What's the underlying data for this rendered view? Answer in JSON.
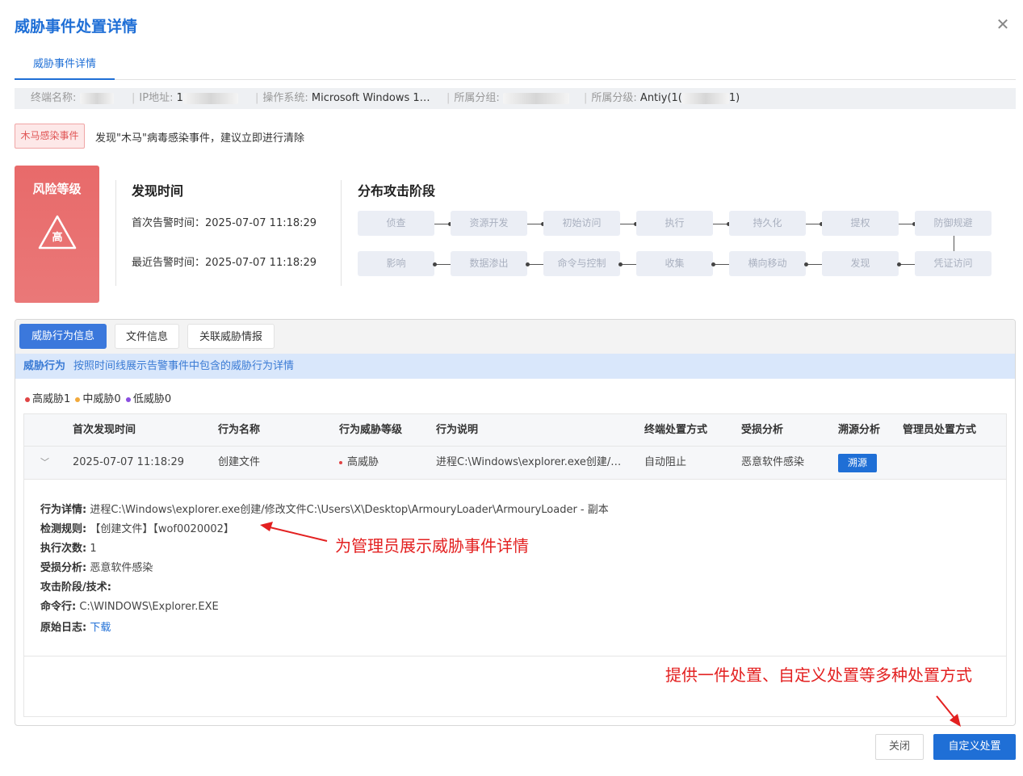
{
  "dialog": {
    "title": "威胁事件处置详情",
    "close_icon": "close-icon"
  },
  "tabs": [
    {
      "label": "威胁事件详情",
      "active": true
    }
  ],
  "terminal_info": {
    "name_label": "终端名称:",
    "name_value": "",
    "ip_label": "IP地址:",
    "ip_value": "1",
    "os_label": "操作系统:",
    "os_value": "Microsoft Windows 1…",
    "group_label": "所属分组:",
    "group_value": "",
    "level_label": "所属分级:",
    "level_value_prefix": "Antiy(1(",
    "level_value_suffix": "1)"
  },
  "event": {
    "tag": "木马感染事件",
    "message": "发现\"木马\"病毒感染事件，建议立即进行清除",
    "tag_color": "#e05555"
  },
  "risk": {
    "title": "风险等级",
    "level": "高",
    "color": "#e86a6a"
  },
  "discovery": {
    "title": "发现时间",
    "first_alert": "首次告警时间：2025-07-07 11:18:29",
    "last_alert": "最近告警时间：2025-07-07 11:18:29"
  },
  "attack_stages": {
    "title": "分布攻击阶段",
    "row1": [
      "侦查",
      "资源开发",
      "初始访问",
      "执行",
      "持久化",
      "提权",
      "防御规避"
    ],
    "row2": [
      "影响",
      "数据渗出",
      "命令与控制",
      "收集",
      "横向移动",
      "发现",
      "凭证访问"
    ]
  },
  "panel_tabs": [
    {
      "label": "威胁行为信息",
      "active": true
    },
    {
      "label": "文件信息",
      "active": false
    },
    {
      "label": "关联威胁情报",
      "active": false
    }
  ],
  "description": {
    "title": "威胁行为",
    "text": "按照时间线展示告警事件中包含的威胁行为详情"
  },
  "legend": [
    {
      "label": "高威胁1",
      "color": "#e04444"
    },
    {
      "label": "中威胁0",
      "color": "#f2a93b"
    },
    {
      "label": "低威胁0",
      "color": "#8a4ee0"
    }
  ],
  "table": {
    "headers": [
      "首次发现时间",
      "行为名称",
      "行为威胁等级",
      "行为说明",
      "终端处置方式",
      "受损分析",
      "溯源分析",
      "管理员处置方式"
    ],
    "rows": [
      {
        "time": "2025-07-07 11:18:29",
        "name": "创建文件",
        "threat_level": "高威胁",
        "description": "进程C:\\Windows\\explorer.exe创建/…",
        "terminal_action": "自动阻止",
        "damage": "恶意软件感染",
        "trace_button": "溯源",
        "admin_action": ""
      }
    ]
  },
  "detail": {
    "behavior_label": "行为详情:",
    "behavior_value": "进程C:\\Windows\\explorer.exe创建/修改文件C:\\Users\\X\\Desktop\\ArmouryLoader\\ArmouryLoader - 副本",
    "rule_label": "检测规则:",
    "rule_value": "【创建文件】【wof0020002】",
    "count_label": "执行次数:",
    "count_value": "1",
    "damage_label": "受损分析:",
    "damage_value": "恶意软件感染",
    "stage_label": "攻击阶段/技术:",
    "stage_value": "",
    "cmd_label": "命令行:",
    "cmd_value": "C:\\WINDOWS\\Explorer.EXE",
    "log_label": "原始日志:",
    "log_link": "下载"
  },
  "annotations": {
    "detail_note": "为管理员展示威胁事件详情",
    "action_note": "提供一件处置、自定义处置等多种处置方式",
    "color": "#e32020"
  },
  "footer": {
    "close_label": "关闭",
    "custom_label": "自定义处置"
  }
}
